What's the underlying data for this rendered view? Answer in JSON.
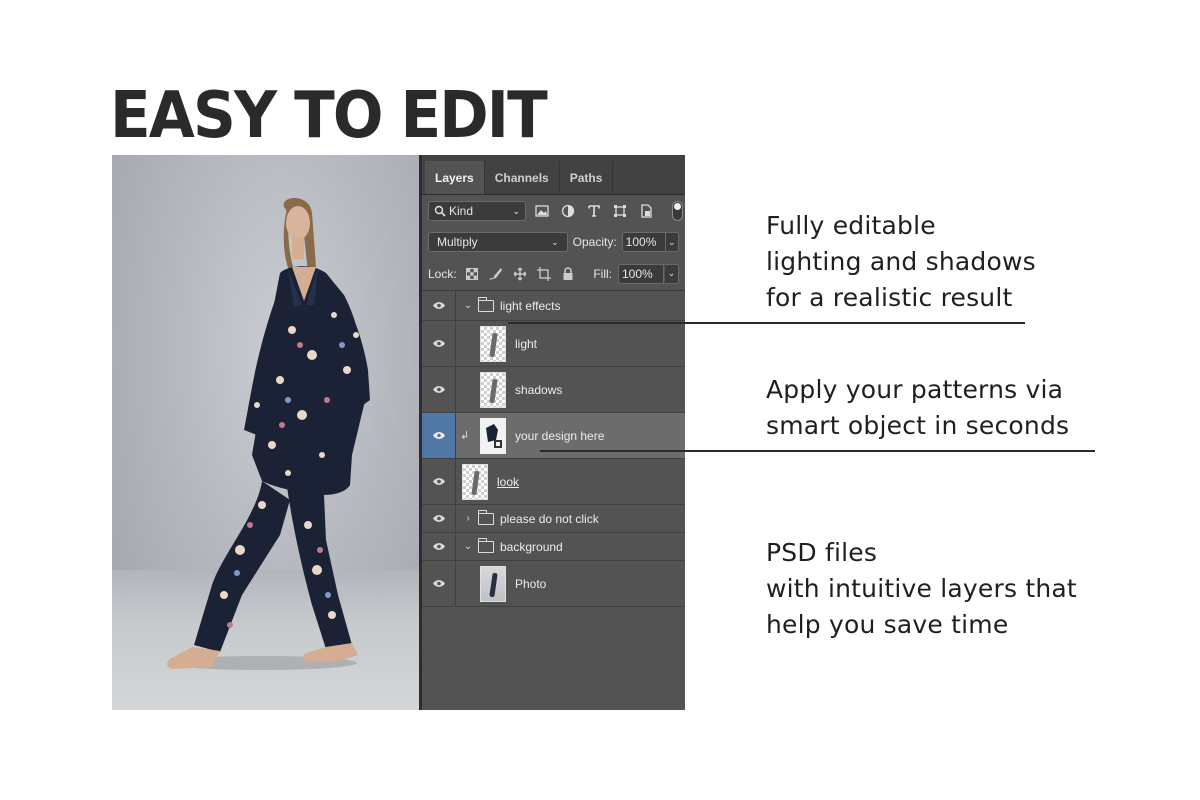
{
  "headline": "EASY TO EDIT",
  "panel": {
    "tabs": [
      "Layers",
      "Channels",
      "Paths"
    ],
    "filter": {
      "label": "Kind"
    },
    "blend_mode": "Multiply",
    "opacity_label": "Opacity:",
    "opacity_value": "100%",
    "lock_label": "Lock:",
    "fill_label": "Fill:",
    "fill_value": "100%",
    "layers": [
      {
        "name": "light effects",
        "type": "group",
        "expanded": true,
        "visible": true
      },
      {
        "name": "light",
        "type": "layer",
        "visible": true
      },
      {
        "name": "shadows",
        "type": "layer",
        "visible": true
      },
      {
        "name": "your design here",
        "type": "smart-object",
        "visible": true,
        "selected": true,
        "clipped": true
      },
      {
        "name": "look",
        "type": "layer",
        "visible": true
      },
      {
        "name": "please do not click",
        "type": "group",
        "expanded": false,
        "visible": true
      },
      {
        "name": "background",
        "type": "group",
        "expanded": true,
        "visible": true
      },
      {
        "name": "Photo",
        "type": "layer",
        "visible": true
      }
    ]
  },
  "notes": [
    {
      "lines": [
        "Fully editable",
        "lighting and shadows",
        "for a realistic result"
      ]
    },
    {
      "lines": [
        "Apply your patterns via",
        "smart object in seconds"
      ]
    },
    {
      "lines": [
        "PSD files",
        "with intuitive layers that",
        "help you save time"
      ]
    }
  ],
  "colors": {
    "panel_bg": "#535353",
    "selected_eye": "#5177a6",
    "pajama_navy": "#1c2236"
  }
}
